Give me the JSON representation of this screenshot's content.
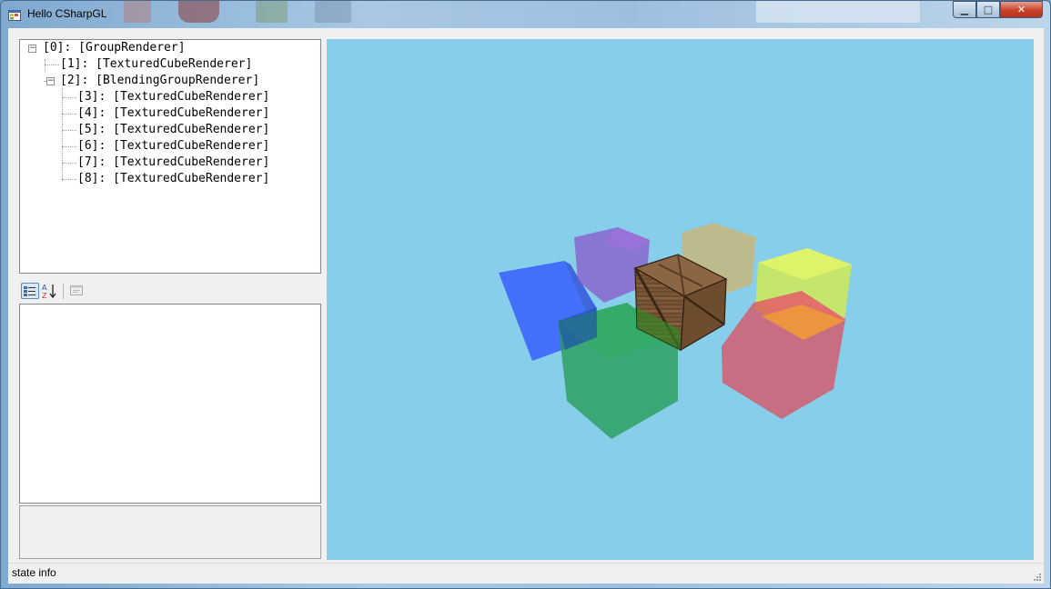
{
  "window": {
    "title": "Hello CSharpGL",
    "buttons": {
      "minimize": "▁",
      "maximize": "□",
      "close": "✕"
    }
  },
  "tree": {
    "nodes": [
      {
        "label": "[0]: [GroupRenderer]",
        "level": 0,
        "expanded": true
      },
      {
        "label": "[1]: [TexturedCubeRenderer]",
        "level": 1
      },
      {
        "label": "[2]: [BlendingGroupRenderer]",
        "level": 1,
        "expanded": true
      },
      {
        "label": "[3]: [TexturedCubeRenderer]",
        "level": 2
      },
      {
        "label": "[4]: [TexturedCubeRenderer]",
        "level": 2
      },
      {
        "label": "[5]: [TexturedCubeRenderer]",
        "level": 2
      },
      {
        "label": "[6]: [TexturedCubeRenderer]",
        "level": 2
      },
      {
        "label": "[7]: [TexturedCubeRenderer]",
        "level": 2
      },
      {
        "label": "[8]: [TexturedCubeRenderer]",
        "level": 2
      }
    ]
  },
  "propertyGrid": {
    "toolbar": [
      "categorized-icon",
      "alphabetical-icon",
      "property-pages-icon"
    ]
  },
  "scene": {
    "background": "#87ceeb",
    "cubes": [
      {
        "name": "blue-cube",
        "color": "#2f55ff"
      },
      {
        "name": "purple-cube",
        "color": "#8a55c8"
      },
      {
        "name": "tan-cube",
        "color": "#d2b46a"
      },
      {
        "name": "yellow-cube",
        "color": "#dcf03a"
      },
      {
        "name": "red-cube",
        "color": "#e04a5a"
      },
      {
        "name": "green-cube",
        "color": "#229a50"
      },
      {
        "name": "wooden-crate",
        "color": "#6b4a2f"
      }
    ]
  },
  "status": {
    "text": "state info"
  }
}
